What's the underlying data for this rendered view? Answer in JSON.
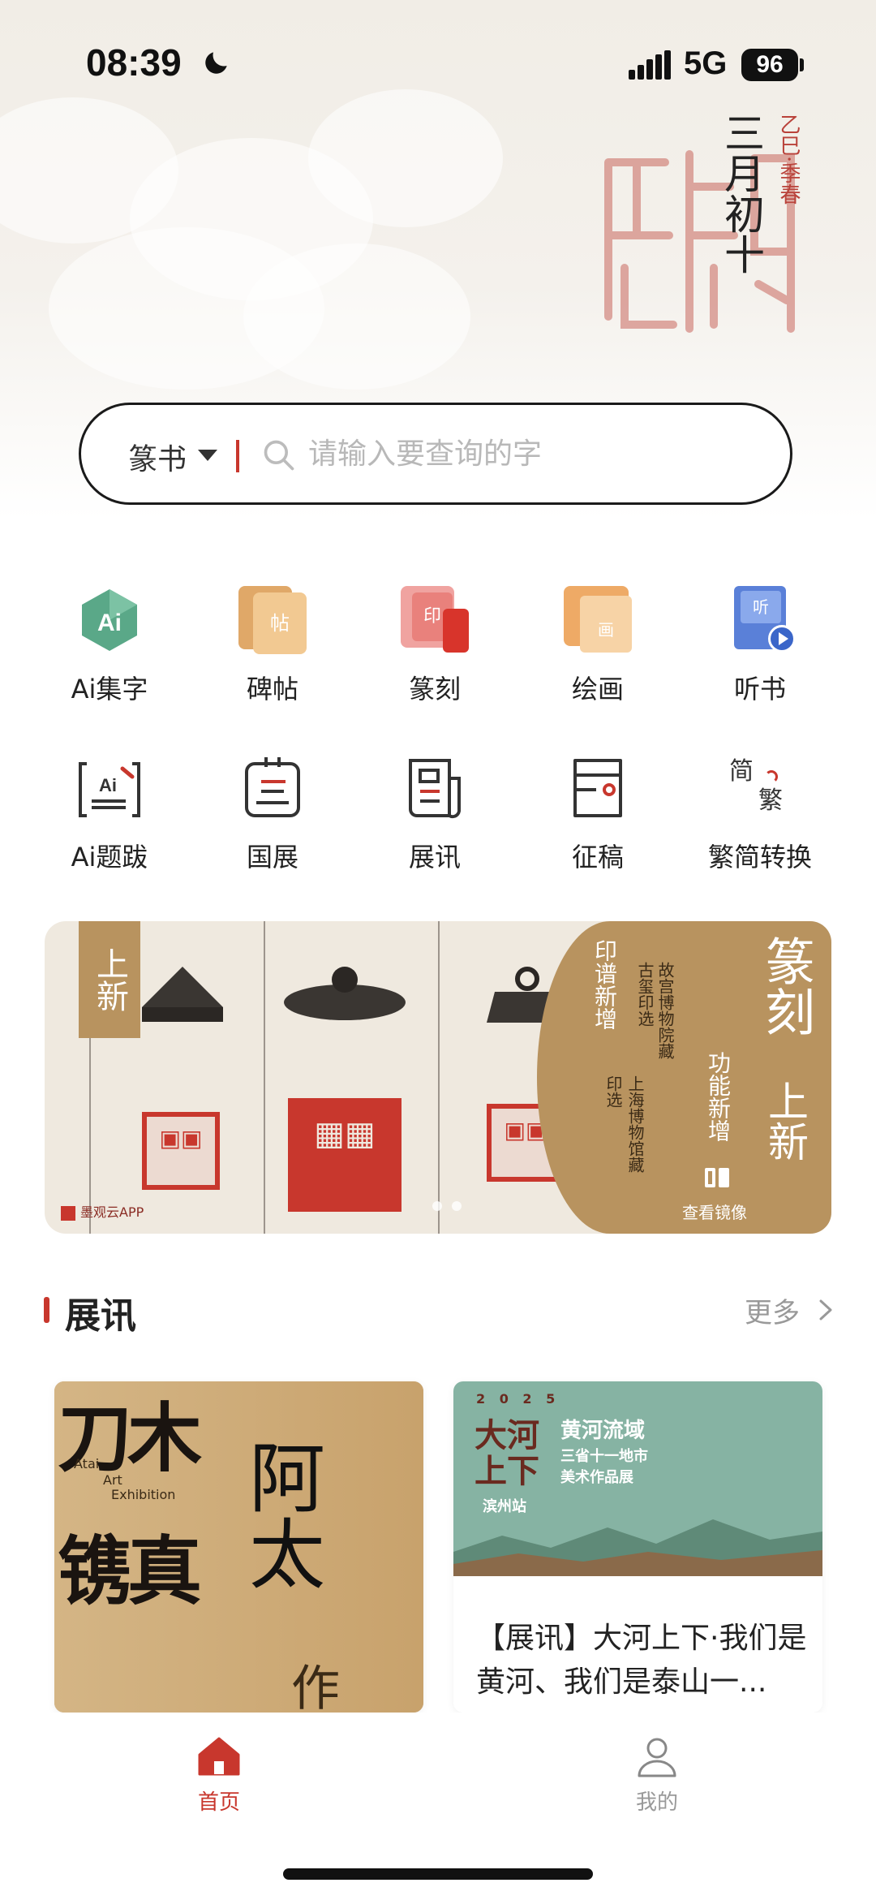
{
  "status_bar": {
    "time": "08:39",
    "network": "5G",
    "battery": "96"
  },
  "lunar": {
    "date": "三月初十",
    "sub": "乙巳·季春"
  },
  "search": {
    "type": "篆书",
    "placeholder": "请输入要查询的字"
  },
  "grid": [
    {
      "label": "Ai集字",
      "icon": "ai-icon"
    },
    {
      "label": "碑帖",
      "icon": "stele-icon",
      "glyph": "帖"
    },
    {
      "label": "篆刻",
      "icon": "seal-icon",
      "glyph": "印"
    },
    {
      "label": "绘画",
      "icon": "painting-icon",
      "glyph": "画"
    },
    {
      "label": "听书",
      "icon": "audiobook-icon",
      "glyph": "听"
    },
    {
      "label": "Ai题跋",
      "icon": "ai-colophon-icon"
    },
    {
      "label": "国展",
      "icon": "national-exhibition-icon"
    },
    {
      "label": "展讯",
      "icon": "exhibition-news-icon"
    },
    {
      "label": "征稿",
      "icon": "submission-icon"
    },
    {
      "label": "繁简转换",
      "icon": "convert-icon",
      "glyph_a": "简",
      "glyph_b": "繁"
    }
  ],
  "banner": {
    "tag": "上新",
    "title_a": "篆刻",
    "title_b": "上新",
    "feature": "功能新增",
    "col1": "印谱新增",
    "col2": "古玺印选",
    "col3": "故宫博物院藏",
    "col4": "印选",
    "col5": "上海博物馆藏",
    "mirror": "查看镜像",
    "app": "墨观云APP"
  },
  "section": {
    "title": "展讯",
    "more": "更多"
  },
  "cards": [
    {
      "en_a": "Atai",
      "en_b": "Art",
      "en_c": "Exhibition",
      "text_a": "刀木",
      "text_b": "镌真",
      "text_c": "阿太",
      "text_d": "作"
    },
    {
      "year": "2 0 2 5",
      "poster_title_a": "大河",
      "poster_title_b": "上下",
      "poster_sub_a": "黄河流域",
      "poster_sub_b": "三省十一地市",
      "poster_sub_c": "美术作品展",
      "poster_station": "滨州站",
      "caption": "【展讯】大河上下·我们是黄河、我们是泰山一..."
    }
  ],
  "tabs": [
    {
      "label": "首页",
      "active": true,
      "icon": "home-icon"
    },
    {
      "label": "我的",
      "active": false,
      "icon": "profile-icon"
    }
  ],
  "colors": {
    "accent": "#c8372d",
    "gold": "#b8935f",
    "text": "#222222",
    "muted": "#999999"
  }
}
